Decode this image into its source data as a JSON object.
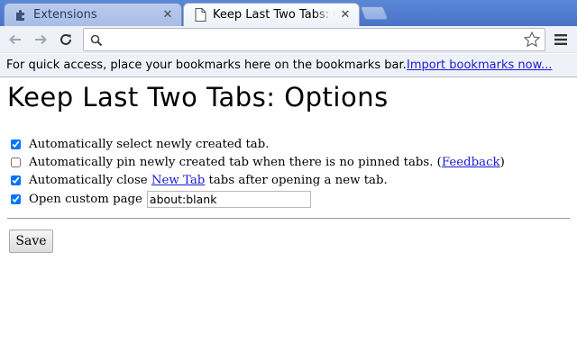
{
  "tabs": [
    {
      "title": "Extensions",
      "active": false,
      "favicon": "puzzle-piece-icon"
    },
    {
      "title": "Keep Last Two Tabs: Options",
      "active": true,
      "favicon": "page-icon"
    }
  ],
  "toolbar": {
    "omnibox_value": "",
    "icons": [
      "back-arrow-icon",
      "forward-arrow-icon",
      "reload-icon",
      "search-icon",
      "star-icon",
      "menu-icon"
    ]
  },
  "bookmarks_bar": {
    "message": "For quick access, place your bookmarks here on the bookmarks bar.",
    "import_link": "Import bookmarks now..."
  },
  "page": {
    "heading": "Keep Last Two Tabs: Options",
    "options": [
      {
        "checked": true,
        "label": "Automatically select newly created tab."
      },
      {
        "checked": false,
        "label": "Automatically pin newly created tab when there is no pinned tabs. (",
        "link": "Feedback",
        "suffix": ")"
      },
      {
        "checked": true,
        "label_before": "Automatically close ",
        "link": "New Tab",
        "label_after": " tabs after opening a new tab."
      },
      {
        "checked": true,
        "label": "Open custom page",
        "input_value": "about:blank"
      }
    ],
    "save_label": "Save"
  }
}
